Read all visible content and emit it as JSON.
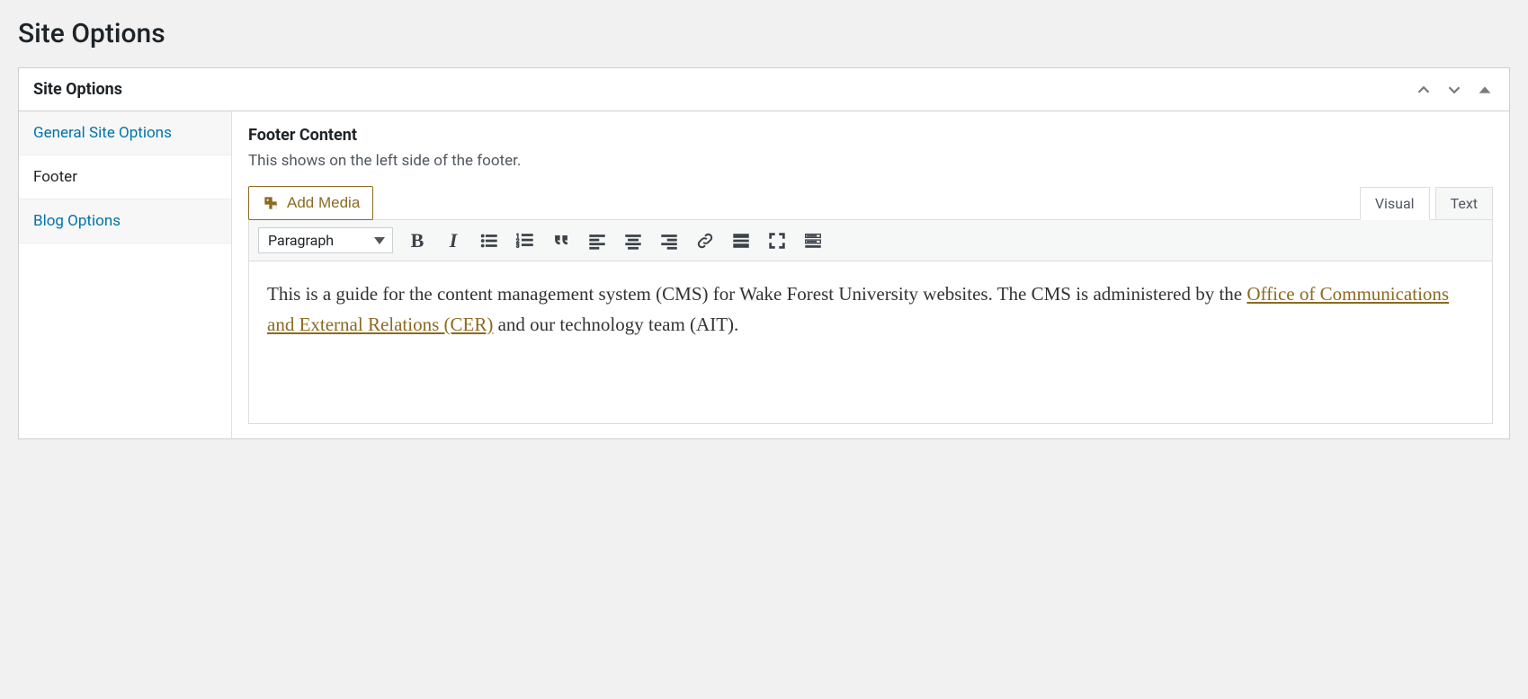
{
  "page": {
    "title": "Site Options"
  },
  "metabox": {
    "title": "Site Options"
  },
  "sidebar": {
    "items": [
      {
        "label": "General Site Options",
        "active": false
      },
      {
        "label": "Footer",
        "active": true
      },
      {
        "label": "Blog Options",
        "active": false
      }
    ]
  },
  "field": {
    "label": "Footer Content",
    "description": "This shows on the left side of the footer."
  },
  "addMedia": {
    "label": "Add Media"
  },
  "editorTabs": {
    "visual": "Visual",
    "text": "Text",
    "active": "visual"
  },
  "toolbar": {
    "format": "Paragraph"
  },
  "editorContent": {
    "prefix": "This is a guide for the content management system (CMS) for Wake Forest University websites. The CMS is administered by the ",
    "linkText": "Office of Communications and External Relations (CER)",
    "suffix": " and our technology team (AIT)."
  }
}
